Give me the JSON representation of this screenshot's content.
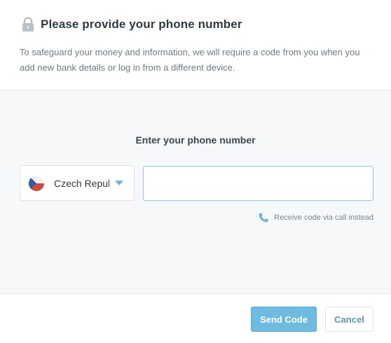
{
  "header": {
    "title": "Please provide your phone number",
    "description": "To safeguard your money and information, we will require a code from you when you add new bank details or log in from a different device.",
    "icon": "lock-icon"
  },
  "form": {
    "enter_label": "Enter your phone number",
    "country": {
      "selected": "Czech Republic",
      "flag_icon": "czech-flag-icon",
      "dropdown_icon": "chevron-down-icon"
    },
    "phone_input": {
      "value": "",
      "placeholder": ""
    },
    "call_option": {
      "label": "Receive code via call instead",
      "icon": "phone-icon"
    }
  },
  "footer": {
    "send_label": "Send Code",
    "cancel_label": "Cancel"
  },
  "colors": {
    "accent": "#6dbbe0",
    "text": "#2e3a44",
    "muted": "#6f7b85",
    "panel": "#f7f8f9"
  }
}
